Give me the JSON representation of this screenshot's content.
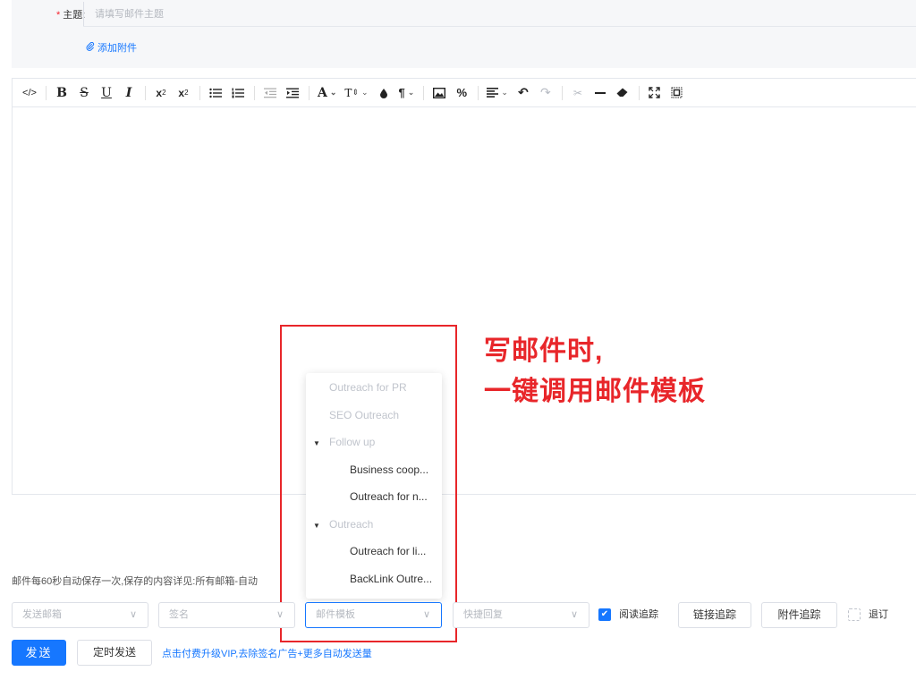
{
  "colors": {
    "accent": "#1677ff",
    "annotation": "#e8262a",
    "required": "#f5222d"
  },
  "subject": {
    "required_mark": "*",
    "label": "主题:",
    "placeholder": "请填写邮件主题"
  },
  "attach_label": "添加附件",
  "toolbar": {
    "items": [
      {
        "name": "source-code-icon",
        "glyph": "</>"
      },
      {
        "name": "bold-icon",
        "glyph": "B"
      },
      {
        "name": "strikethrough-icon",
        "glyph": "S"
      },
      {
        "name": "underline-icon",
        "glyph": "U"
      },
      {
        "name": "italic-icon",
        "glyph": "I"
      },
      {
        "name": "superscript-icon",
        "glyph": "x²"
      },
      {
        "name": "subscript-icon",
        "glyph": "x₂"
      },
      {
        "name": "bullet-list-icon",
        "glyph": "☰"
      },
      {
        "name": "numbered-list-icon",
        "glyph": "☷"
      },
      {
        "name": "outdent-icon",
        "glyph": "⇤"
      },
      {
        "name": "indent-icon",
        "glyph": "⇥"
      },
      {
        "name": "font-color-icon",
        "glyph": "A"
      },
      {
        "name": "font-size-icon",
        "glyph": "T⇕"
      },
      {
        "name": "highlight-icon",
        "glyph": "●"
      },
      {
        "name": "paragraph-icon",
        "glyph": "¶"
      },
      {
        "name": "image-icon",
        "glyph": "▣"
      },
      {
        "name": "link-icon",
        "glyph": "%"
      },
      {
        "name": "align-icon",
        "glyph": "≡"
      },
      {
        "name": "undo-icon",
        "glyph": "↶"
      },
      {
        "name": "redo-icon",
        "glyph": "↷"
      },
      {
        "name": "cut-icon",
        "glyph": "✂"
      },
      {
        "name": "horizontal-rule-icon",
        "glyph": "—"
      },
      {
        "name": "eraser-icon",
        "glyph": "⌫"
      },
      {
        "name": "fullscreen-icon",
        "glyph": "⛶"
      },
      {
        "name": "preview-icon",
        "glyph": "⊡"
      }
    ]
  },
  "template_dropdown": {
    "items": [
      {
        "label": "Outreach for PR",
        "kind": "disabled"
      },
      {
        "label": "SEO Outreach",
        "kind": "disabled"
      },
      {
        "label": "Follow up",
        "kind": "group"
      },
      {
        "label": "Business coop...",
        "kind": "child"
      },
      {
        "label": "Outreach for n...",
        "kind": "child"
      },
      {
        "label": "Outreach",
        "kind": "group"
      },
      {
        "label": "Outreach for li...",
        "kind": "child"
      },
      {
        "label": "BackLink Outre...",
        "kind": "child"
      }
    ]
  },
  "annotation": {
    "line1": "写邮件时,",
    "line2": "一键调用邮件模板"
  },
  "autosave_note": "邮件每60秒自动保存一次,保存的内容详见:所有邮箱-自动",
  "footer": {
    "sender_placeholder": "发送邮箱",
    "signature_placeholder": "签名",
    "template_placeholder": "邮件模板",
    "quick_reply_placeholder": "快捷回复",
    "read_tracking": "阅读追踪",
    "link_tracking": "链接追踪",
    "attachment_tracking": "附件追踪",
    "unsubscribe": "退订",
    "send": "发送",
    "scheduled_send": "定时发送",
    "vip_link": "点击付费升级VIP,去除签名广告+更多自动发送量"
  }
}
